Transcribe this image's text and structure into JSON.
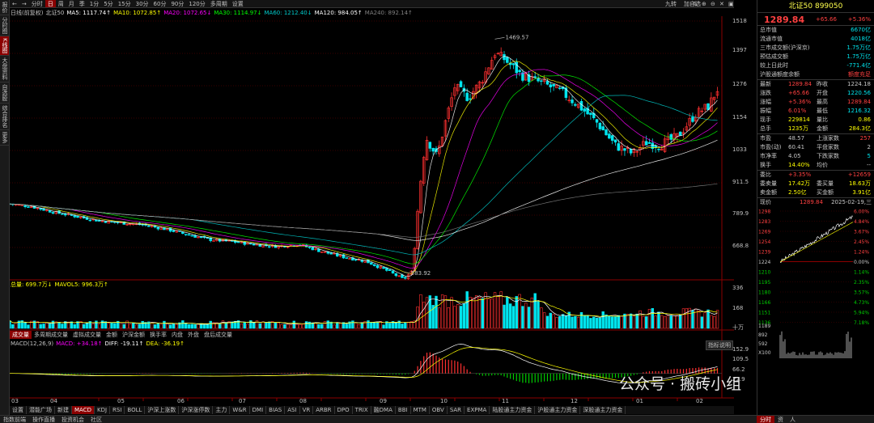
{
  "left_tabs": [
    "报价",
    "分时图",
    "K线图",
    "大盘资料",
    "自选股",
    "综合排名",
    "更多"
  ],
  "left_tabs_active": 2,
  "toolbar": {
    "items": [
      "←",
      "→",
      "分时",
      "日",
      "周",
      "月",
      "季",
      "1分",
      "5分",
      "15分",
      "30分",
      "60分",
      "90分",
      "120分",
      "多周期",
      "设置"
    ],
    "active": 3,
    "right_items": [
      "九转",
      "加自选",
      "⇅",
      "⊕",
      "⊖",
      "✕",
      "▣",
      "⌂"
    ]
  },
  "main_legend": [
    {
      "text": "日线(前复权)",
      "color": "#c0c0c0"
    },
    {
      "text": "北证50",
      "color": "#c0c0c0"
    },
    {
      "text": "MA5: 1117.74↑",
      "color": "#ffffff"
    },
    {
      "text": "MA10: 1072.85↑",
      "color": "#ffff00"
    },
    {
      "text": "MA20: 1072.65↓",
      "color": "#ff00ff"
    },
    {
      "text": "MA30: 1114.97↓",
      "color": "#00ff00"
    },
    {
      "text": "MA60: 1212.40↓",
      "color": "#00cccc"
    },
    {
      "text": "MA120: 984.05↑",
      "color": "#ffffff"
    },
    {
      "text": "MA240: 892.14↑",
      "color": "#808080"
    }
  ],
  "price_axis": [
    "1518",
    "1397",
    "1276",
    "1154",
    "1033",
    "911.5",
    "789.9",
    "668.8"
  ],
  "annotations": {
    "high": "1469.57",
    "low": "583.92"
  },
  "volume_legend": [
    {
      "text": "总量: 699.7万↓",
      "color": "#ffff00"
    },
    {
      "text": "MAVOL5: 996.3万↑",
      "color": "#ffff00"
    }
  ],
  "volume_axis": [
    "336",
    "168",
    "十万"
  ],
  "indicator_tabs": [
    "成交量",
    "多周期成交量",
    "虚拟成交量",
    "金额",
    "沪深金额",
    "换手率",
    "内盘",
    "外盘",
    "盘后成交量"
  ],
  "indicator_active": 0,
  "macd_legend": [
    {
      "text": "MACD(12,26,9)",
      "color": "#c0c0c0"
    },
    {
      "text": "MACD: +34.18↑",
      "color": "#ff00ff"
    },
    {
      "text": "DIFF: -19.11↑",
      "color": "#ffffff"
    },
    {
      "text": "DEA: -36.19↑",
      "color": "#ffff00"
    }
  ],
  "macd_button": "指标说明",
  "macd_axis": [
    "152.9",
    "109.5",
    "66.2",
    "22.9"
  ],
  "x_labels": [
    "03",
    "04",
    "05",
    "06",
    "07",
    "08",
    "09",
    "10",
    "11",
    "12",
    "01",
    "02"
  ],
  "bottom_tabs": [
    "设置",
    "潜能广场",
    "新建",
    "MACD",
    "KDJ",
    "RSI",
    "BOLL",
    "沪深上涨数",
    "沪深涨停数",
    "主力",
    "W&R",
    "DMI",
    "BIAS",
    "ASI",
    "VR",
    "ARBR",
    "DPO",
    "TRIX",
    "融DMA",
    "BBI",
    "MTM",
    "OBV",
    "SAR",
    "EXPMA",
    "陆股通主力资金",
    "沪股通主力资金",
    "深股通主力资金"
  ],
  "bottom_active": 3,
  "status_bar": [
    "指数前端",
    "操作直播",
    "投资机会",
    "社区"
  ],
  "status_right": [
    "分时",
    "资",
    "人"
  ],
  "watermark": "公众号 · 搬砖小组",
  "panel": {
    "title": "北证50 899050",
    "price": "1289.84",
    "change": "+65.66",
    "change_pct": "+5.36%",
    "info": [
      {
        "label": "总市值",
        "value": "6670亿"
      },
      {
        "label": "流通市值",
        "value": "4018亿"
      },
      {
        "label": "三市成交额(沪深京)",
        "value": "1.75万亿"
      },
      {
        "label": "预估成交额",
        "value": "1.75万亿"
      },
      {
        "label": "较上日此时",
        "value": "-771.4亿"
      },
      {
        "label": "沪股通额度余额",
        "value": "额度充足"
      }
    ],
    "quote": [
      {
        "l1": "最新",
        "v1": "1289.84",
        "l2": "昨收",
        "v2": "1224.18"
      },
      {
        "l1": "涨跌",
        "v1": "+65.66",
        "l2": "开盘",
        "v2": "1220.56"
      },
      {
        "l1": "涨幅",
        "v1": "+5.36%",
        "l2": "最高",
        "v2": "1289.84"
      },
      {
        "l1": "振幅",
        "v1": "6.01%",
        "l2": "最低",
        "v2": "1216.32"
      },
      {
        "l1": "现手",
        "v1": "229814",
        "l2": "量比",
        "v2": "0.86"
      },
      {
        "l1": "总手",
        "v1": "1235万",
        "l2": "金额",
        "v2": "284.3亿"
      }
    ],
    "stats": [
      {
        "l1": "市盈",
        "v1": "48.57",
        "l2": "上涨家数",
        "v2": "257"
      },
      {
        "l1": "市盈(动)",
        "v1": "60.41",
        "l2": "平盘家数",
        "v2": "2"
      },
      {
        "l1": "市净率",
        "v1": "4.05",
        "l2": "下跌家数",
        "v2": "5"
      },
      {
        "l1": "换手",
        "v1": "14.40%",
        "l2": "均价",
        "v2": "--"
      }
    ],
    "order": [
      {
        "l1": "委比",
        "v1": "+3.35%",
        "v2": "+12659"
      },
      {
        "l1": "委卖量",
        "v1": "17.42万",
        "l2": "委买量",
        "v2": "18.63万"
      },
      {
        "l1": "卖金额",
        "v1": "2.50亿",
        "l2": "买金额",
        "v2": "3.91亿"
      }
    ],
    "mini_head": {
      "label": "现价",
      "price": "1289.84",
      "date": "2025-02-19,三"
    },
    "mini_left_axis": [
      "1298",
      "1283",
      "1269",
      "1254",
      "1239",
      "1224",
      "1210",
      "1195",
      "1180",
      "1166",
      "1151",
      "1136"
    ],
    "mini_right_axis": [
      "6.00%",
      "4.84%",
      "3.67%",
      "2.45%",
      "1.24%",
      "0.00%",
      "1.14%",
      "2.35%",
      "3.57%",
      "4.73%",
      "5.94%",
      "7.18%"
    ],
    "mini_vol_axis": [
      "1189",
      "892",
      "592",
      "X100"
    ]
  },
  "colors": {
    "up": "#ff3030",
    "down": "#00e5ee",
    "accent": "#8b0000"
  },
  "chart_data": {
    "type": "candlestick",
    "title": "北证50",
    "x_labels": [
      "03",
      "04",
      "05",
      "06",
      "07",
      "08",
      "09",
      "10",
      "11",
      "12",
      "01",
      "02"
    ],
    "ylim": [
      620,
      1540
    ],
    "high": 1469.57,
    "low": 583.92,
    "close_path": [
      {
        "m": 0,
        "v": 880
      },
      {
        "m": 0.5,
        "v": 870
      },
      {
        "m": 1,
        "v": 850
      },
      {
        "m": 1.5,
        "v": 835
      },
      {
        "m": 2,
        "v": 820
      },
      {
        "m": 2.5,
        "v": 812
      },
      {
        "m": 3,
        "v": 805
      },
      {
        "m": 3.5,
        "v": 790
      },
      {
        "m": 4,
        "v": 770
      },
      {
        "m": 4.5,
        "v": 752
      },
      {
        "m": 5,
        "v": 745
      },
      {
        "m": 5.5,
        "v": 735
      },
      {
        "m": 6,
        "v": 728
      },
      {
        "m": 6.5,
        "v": 735
      },
      {
        "m": 7,
        "v": 710
      },
      {
        "m": 7.5,
        "v": 690
      },
      {
        "m": 8,
        "v": 675
      },
      {
        "m": 8.5,
        "v": 640
      },
      {
        "m": 8.85,
        "v": 610
      },
      {
        "m": 9.05,
        "v": 640
      },
      {
        "m": 9.2,
        "v": 920
      },
      {
        "m": 9.35,
        "v": 1120
      },
      {
        "m": 9.6,
        "v": 1050
      },
      {
        "m": 9.8,
        "v": 1180
      },
      {
        "m": 10,
        "v": 1300
      },
      {
        "m": 10.3,
        "v": 1260
      },
      {
        "m": 10.6,
        "v": 1320
      },
      {
        "m": 10.9,
        "v": 1420
      },
      {
        "m": 11.1,
        "v": 1400
      },
      {
        "m": 11.5,
        "v": 1340
      },
      {
        "m": 12,
        "v": 1310
      },
      {
        "m": 12.4,
        "v": 1280
      },
      {
        "m": 12.8,
        "v": 1230
      },
      {
        "m": 13.2,
        "v": 1170
      },
      {
        "m": 13.6,
        "v": 1090
      },
      {
        "m": 14,
        "v": 1060
      },
      {
        "m": 14.3,
        "v": 1100
      },
      {
        "m": 14.6,
        "v": 1090
      },
      {
        "m": 15,
        "v": 1120
      },
      {
        "m": 15.4,
        "v": 1200
      },
      {
        "m": 15.7,
        "v": 1230
      },
      {
        "m": 15.9,
        "v": 1289.84
      }
    ],
    "ma_series": [
      {
        "name": "MA5",
        "color": "#ffffff",
        "value": 1117.74
      },
      {
        "name": "MA10",
        "color": "#ffff00",
        "value": 1072.85
      },
      {
        "name": "MA20",
        "color": "#ff00ff",
        "value": 1072.65
      },
      {
        "name": "MA30",
        "color": "#00ff00",
        "value": 1114.97
      },
      {
        "name": "MA60",
        "color": "#00cccc",
        "value": 1212.4
      },
      {
        "name": "MA120",
        "color": "#ffffff",
        "value": 984.05
      },
      {
        "name": "MA240",
        "color": "#808080",
        "value": 892.14
      }
    ],
    "volume": {
      "latest": "699.7万",
      "mavol5": "996.3万",
      "ylim": [
        0,
        360
      ]
    },
    "macd": {
      "macd": 34.18,
      "diff": -19.11,
      "dea": -36.19,
      "ylim": [
        -120,
        160
      ]
    }
  }
}
